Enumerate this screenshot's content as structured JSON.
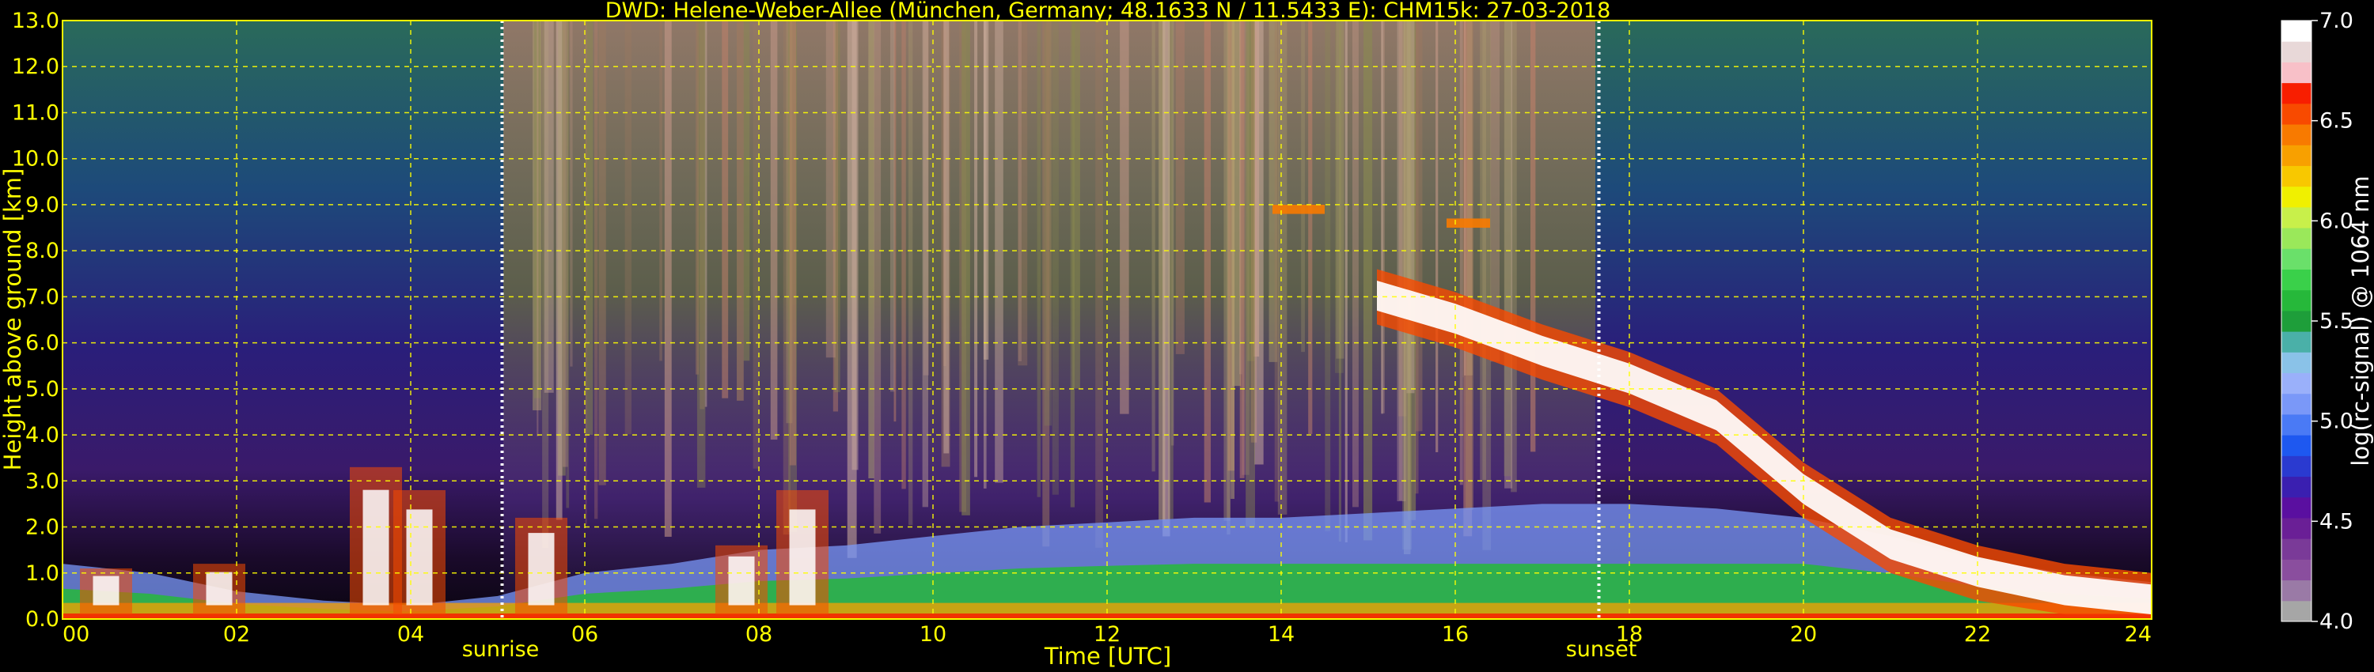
{
  "chart_data": {
    "type": "heatmap",
    "title": "DWD: Helene-Weber-Allee (München, Germany; 48.1633 N / 11.5433 E):    CHM15k: 27-03-2018",
    "xlabel": "Time [UTC]",
    "ylabel": "Height above ground [km]",
    "xlim": [
      0,
      24
    ],
    "ylim": [
      0.0,
      13.0
    ],
    "x_ticks": [
      "00",
      "02",
      "04",
      "06",
      "08",
      "10",
      "12",
      "14",
      "16",
      "18",
      "20",
      "22",
      "24"
    ],
    "y_ticks": [
      "0.0",
      "1.0",
      "2.0",
      "3.0",
      "4.0",
      "5.0",
      "6.0",
      "7.0",
      "8.0",
      "9.0",
      "10.0",
      "11.0",
      "12.0",
      "13.0"
    ],
    "grid": true,
    "annotations": [
      {
        "text": "sunrise",
        "x": 5.05
      },
      {
        "text": "sunset",
        "x": 17.65
      }
    ],
    "colorbar": {
      "label": "log(rc-signal) @ 1064 nm",
      "range": [
        4.0,
        7.0
      ],
      "ticks": [
        "4.0",
        "4.5",
        "5.0",
        "5.5",
        "6.0",
        "6.5",
        "7.0"
      ],
      "colors": [
        "#a6a6a6",
        "#9a7aa6",
        "#8a4e9e",
        "#7a3a98",
        "#6a1f96",
        "#5a0fa0",
        "#3a1fb0",
        "#2a3ad0",
        "#1e58f0",
        "#4a7af5",
        "#7a98f8",
        "#9ab0fa",
        "#8ac2e8",
        "#4ab0a8",
        "#1e9e3a",
        "#26b83a",
        "#3ad04a",
        "#6ae06a",
        "#9ae85a",
        "#c8f04a",
        "#f0f000",
        "#f8c800",
        "#f8a000",
        "#f87a00",
        "#f84a00",
        "#f81e00",
        "#f8c0c8",
        "#e8d8d8",
        "#ffffff"
      ]
    },
    "profile_features": {
      "boundary_layer_top_km": [
        1.2,
        1.0,
        0.6,
        0.4,
        0.3,
        0.5,
        1.0,
        1.2,
        1.5,
        1.6,
        1.8,
        2.0,
        2.1,
        2.2,
        2.2,
        2.3,
        2.4,
        2.5,
        2.5,
        2.4,
        2.2,
        1.8,
        1.3,
        1.0,
        0.8
      ],
      "cloud_layer": [
        {
          "x": 15.1,
          "y": 7.2
        },
        {
          "x": 16.0,
          "y": 6.7
        },
        {
          "x": 17.0,
          "y": 6.0
        },
        {
          "x": 18.0,
          "y": 5.4
        },
        {
          "x": 19.0,
          "y": 4.6
        },
        {
          "x": 20.0,
          "y": 3.0
        },
        {
          "x": 21.0,
          "y": 1.8
        },
        {
          "x": 22.0,
          "y": 1.2
        },
        {
          "x": 23.0,
          "y": 0.8
        },
        {
          "x": 24.0,
          "y": 0.6
        }
      ]
    }
  }
}
